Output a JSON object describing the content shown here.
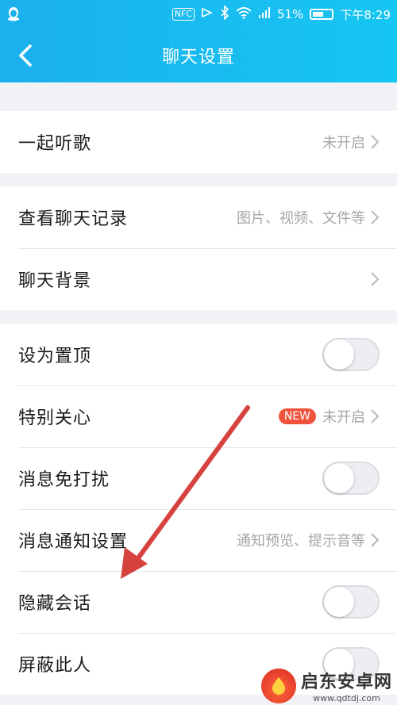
{
  "status_bar": {
    "nfc": "NFC",
    "battery_percent": "51%",
    "time": "下午8:29"
  },
  "nav": {
    "title": "聊天设置"
  },
  "groups": [
    {
      "rows": [
        {
          "label": "一起听歌",
          "value": "未开启"
        }
      ]
    },
    {
      "rows": [
        {
          "label": "查看聊天记录",
          "value": "图片、视频、文件等"
        },
        {
          "label": "聊天背景",
          "value": ""
        }
      ]
    },
    {
      "rows": [
        {
          "label": "设为置顶",
          "toggle": false
        },
        {
          "label": "特别关心",
          "badge": "NEW",
          "value": "未开启"
        },
        {
          "label": "消息免打扰",
          "toggle": false
        },
        {
          "label": "消息通知设置",
          "value": "通知预览、提示音等"
        },
        {
          "label": "隐藏会话",
          "toggle": false
        },
        {
          "label": "屏蔽此人",
          "toggle": false
        }
      ]
    }
  ],
  "watermark": {
    "name": "启东安卓网",
    "url": "www.qdtdj.com"
  },
  "colors": {
    "header": "#16c6f2",
    "arrow": "#d6433f",
    "badge": "#f0533c"
  }
}
